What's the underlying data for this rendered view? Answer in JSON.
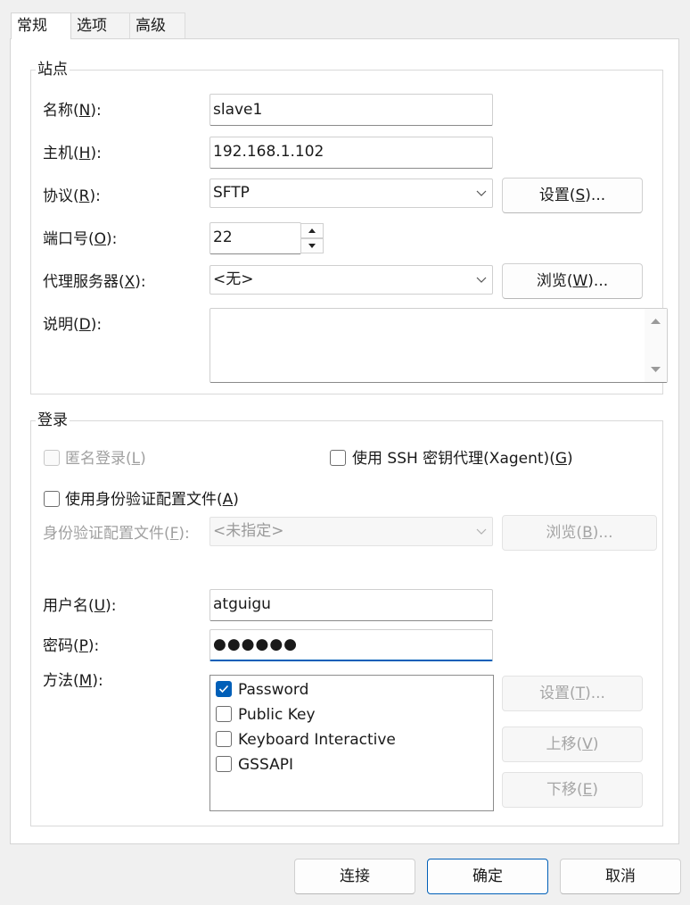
{
  "tabs": [
    "常规",
    "选项",
    "高级"
  ],
  "site": {
    "title": "站点",
    "name_label_pre": "名称(",
    "name_label_key": "N",
    "name_label_post": "):",
    "name_value": "slave1",
    "host_label_pre": "主机(",
    "host_label_key": "H",
    "host_label_post": "):",
    "host_value": "192.168.1.102",
    "protocol_label_pre": "协议(",
    "protocol_label_key": "R",
    "protocol_label_post": "):",
    "protocol_value": "SFTP",
    "protocol_settings_pre": "设置(",
    "protocol_settings_key": "S",
    "protocol_settings_post": ")...",
    "port_label_pre": "端口号(",
    "port_label_key": "O",
    "port_label_post": "):",
    "port_value": "22",
    "proxy_label_pre": "代理服务器(",
    "proxy_label_key": "X",
    "proxy_label_post": "):",
    "proxy_value": "<无>",
    "proxy_browse_pre": "浏览(",
    "proxy_browse_key": "W",
    "proxy_browse_post": ")...",
    "desc_label_pre": "说明(",
    "desc_label_key": "D",
    "desc_label_post": "):",
    "desc_value": ""
  },
  "login": {
    "title": "登录",
    "anonymous_pre": "匿名登录(",
    "anonymous_key": "L",
    "anonymous_post": ")",
    "anonymous_checked": false,
    "xagent_pre": "使用 SSH 密钥代理(Xagent)(",
    "xagent_key": "G",
    "xagent_post": ")",
    "xagent_checked": false,
    "use_profile_pre": "使用身份验证配置文件(",
    "use_profile_key": "A",
    "use_profile_post": ")",
    "use_profile_checked": false,
    "profile_label_pre": "身份验证配置文件(",
    "profile_label_key": "F",
    "profile_label_post": "):",
    "profile_value": "<未指定>",
    "profile_browse_pre": "浏览(",
    "profile_browse_key": "B",
    "profile_browse_post": ")...",
    "username_label_pre": "用户名(",
    "username_label_key": "U",
    "username_label_post": "):",
    "username_value": "atguigu",
    "password_label_pre": "密码(",
    "password_label_key": "P",
    "password_label_post": "):",
    "password_value": "●●●●●●",
    "method_label_pre": "方法(",
    "method_label_key": "M",
    "method_label_post": "):",
    "methods": [
      {
        "label": "Password",
        "checked": true
      },
      {
        "label": "Public Key",
        "checked": false
      },
      {
        "label": "Keyboard Interactive",
        "checked": false
      },
      {
        "label": "GSSAPI",
        "checked": false
      }
    ],
    "method_settings_pre": "设置(",
    "method_settings_key": "T",
    "method_settings_post": ")...",
    "move_up_pre": "上移(",
    "move_up_key": "V",
    "move_up_post": ")",
    "move_down_pre": "下移(",
    "move_down_key": "E",
    "move_down_post": ")"
  },
  "footer": {
    "connect": "连接",
    "ok": "确定",
    "cancel": "取消"
  },
  "colors": {
    "accent": "#005fb8",
    "disabled_text": "#a0a0a0",
    "dialog_bg": "#f0f0f0"
  },
  "icons": {
    "combo": "chevron-down-icon",
    "spin_up": "triangle-up-icon",
    "spin_down": "triangle-down-icon",
    "check": "checkmark-icon"
  }
}
